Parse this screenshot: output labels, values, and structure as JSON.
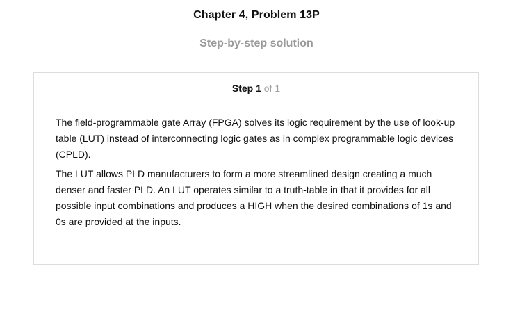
{
  "header": {
    "title": "Chapter 4, Problem 13P",
    "subtitle": "Step-by-step solution"
  },
  "step": {
    "label": "Step 1",
    "total": "of 1",
    "paragraphs": [
      "The field-programmable gate Array (FPGA) solves its logic requirement by the use of look-up table (LUT) instead of interconnecting logic gates as in complex programmable logic devices (CPLD).",
      "The LUT allows PLD manufacturers to form a more streamlined design creating a much denser and faster PLD. An LUT operates similar to a truth-table in that it provides for all possible input combinations and produces a HIGH when the desired combinations of 1s and 0s are provided at the inputs."
    ]
  },
  "colors": {
    "subtitle": "#9a9a9a",
    "card_border": "#dddddd",
    "step_total": "#a0a0a0"
  }
}
